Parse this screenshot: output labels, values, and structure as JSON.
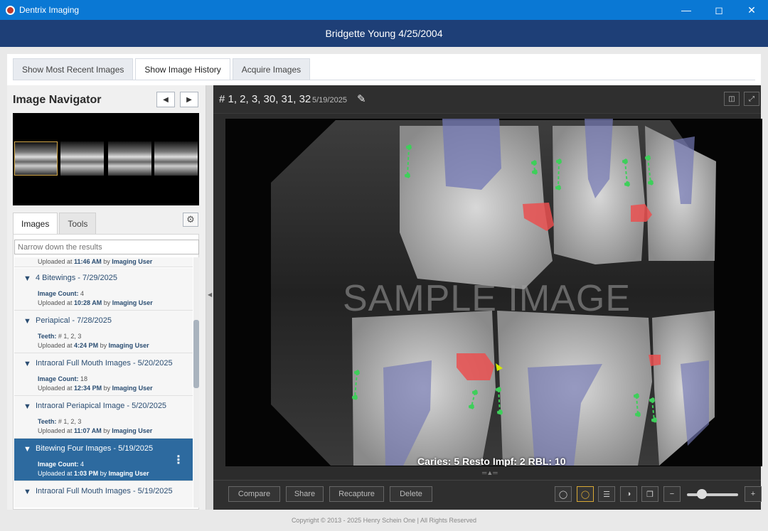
{
  "window": {
    "title": "Dentrix Imaging",
    "min_icon": "minimize-icon",
    "max_icon": "maximize-icon",
    "close_icon": "close-icon"
  },
  "patient": {
    "header": "Bridgette Young 4/25/2004"
  },
  "tabs": [
    {
      "label": "Show Most Recent Images"
    },
    {
      "label": "Show Image History"
    },
    {
      "label": "Acquire Images"
    }
  ],
  "navigator": {
    "title": "Image Navigator",
    "subtabs": [
      {
        "label": "Images"
      },
      {
        "label": "Tools"
      }
    ],
    "search_placeholder": "Narrow down the results",
    "items": [
      {
        "title": "",
        "l1_pre": "Uploaded at ",
        "l1_time": "11:46 AM",
        "l1_mid": " by ",
        "l1_user": "Imaging User"
      },
      {
        "title": "4 Bitewings - 7/29/2025",
        "l1_label": "Image Count: ",
        "l1_value": "4",
        "l2_pre": "Uploaded at ",
        "l2_time": "10:28 AM",
        "l2_mid": " by ",
        "l2_user": "Imaging User"
      },
      {
        "title": "Periapical - 7/28/2025",
        "l1_label": "Teeth: ",
        "l1_value": "# 1, 2, 3",
        "l2_pre": "Uploaded at ",
        "l2_time": "4:24 PM",
        "l2_mid": " by ",
        "l2_user": "Imaging User"
      },
      {
        "title": "Intraoral Full Mouth Images - 5/20/2025",
        "l1_label": "Image Count: ",
        "l1_value": "18",
        "l2_pre": "Uploaded at ",
        "l2_time": "12:34 PM",
        "l2_mid": " by ",
        "l2_user": "Imaging User"
      },
      {
        "title": "Intraoral Periapical Image - 5/20/2025",
        "l1_label": "Teeth: ",
        "l1_value": "# 1, 2, 3",
        "l2_pre": "Uploaded at ",
        "l2_time": "11:07 AM",
        "l2_mid": " by ",
        "l2_user": "Imaging User"
      },
      {
        "title": "Bitewing Four Images - 5/19/2025",
        "l1_label": "Image Count: ",
        "l1_value": "4",
        "l2_pre": "Uploaded at ",
        "l2_time": "1:03 PM",
        "l2_mid": " by ",
        "l2_user": "Imaging User"
      },
      {
        "title": "Intraoral Full Mouth Images - 5/19/2025"
      }
    ]
  },
  "viewer": {
    "title": "# 1, 2, 3, 30, 31, 32",
    "date": "5/19/2025",
    "watermark": "SAMPLE IMAGE",
    "stats": "Caries: 5 Resto Impf: 2 RBL: 10",
    "toolbar": {
      "compare": "Compare",
      "share": "Share",
      "recapture": "Recapture",
      "delete": "Delete",
      "zoom_out": "−",
      "zoom_in": "+"
    }
  },
  "footer": "Copyright © 2013 - 2025 Henry Schein One | All Rights Reserved",
  "colors": {
    "titlebar": "#0a78d4",
    "patientbar": "#1e3f77",
    "selected": "#2d6a9f",
    "accent": "#d9a935"
  }
}
